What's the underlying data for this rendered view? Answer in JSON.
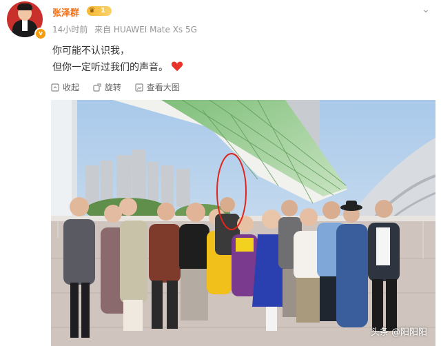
{
  "post": {
    "username": "张泽群",
    "vip_level": "1",
    "verified_mark": "v",
    "time": "14小时前",
    "source": "来自 HUAWEI Mate Xs 5G",
    "text_lines": [
      "你可能不认识我，",
      "但你一定听过我们的声音。"
    ],
    "heart_icon": "heart-icon"
  },
  "actions": {
    "collapse_label": "收起",
    "rotate_label": "旋转",
    "view_large_label": "查看大图"
  },
  "photo": {
    "watermark": "头条 @阳阳阳",
    "highlight_color": "#e0251b"
  }
}
